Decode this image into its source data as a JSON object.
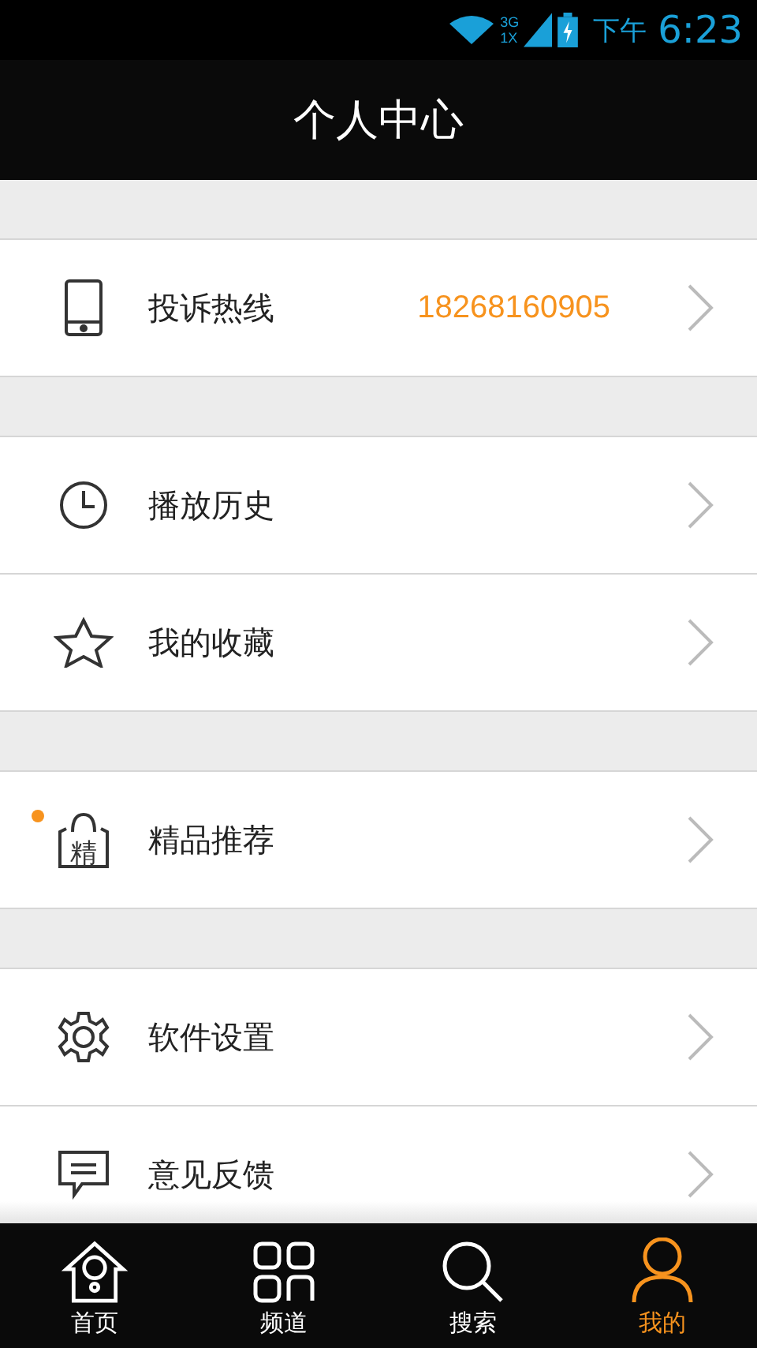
{
  "status_bar": {
    "network_top": "3G",
    "network_bottom": "1X",
    "period": "下午",
    "time": "6:23"
  },
  "header": {
    "title": "个人中心"
  },
  "sections": [
    {
      "items": [
        {
          "kind": "phone",
          "label": "投诉热线",
          "value": "18268160905",
          "dot": false
        }
      ]
    },
    {
      "items": [
        {
          "kind": "history",
          "label": "播放历史",
          "dot": false
        },
        {
          "kind": "favorite",
          "label": "我的收藏",
          "dot": false
        }
      ]
    },
    {
      "items": [
        {
          "kind": "featured",
          "label": "精品推荐",
          "icon_char": "精",
          "dot": true
        }
      ]
    },
    {
      "items": [
        {
          "kind": "settings",
          "label": "软件设置",
          "dot": false
        },
        {
          "kind": "feedback",
          "label": "意见反馈",
          "dot": false
        }
      ]
    }
  ],
  "tabs": [
    {
      "kind": "home",
      "label": "首页",
      "selected": false
    },
    {
      "kind": "channels",
      "label": "频道",
      "selected": false
    },
    {
      "kind": "search",
      "label": "搜索",
      "selected": false
    },
    {
      "kind": "profile",
      "label": "我的",
      "selected": true
    }
  ]
}
